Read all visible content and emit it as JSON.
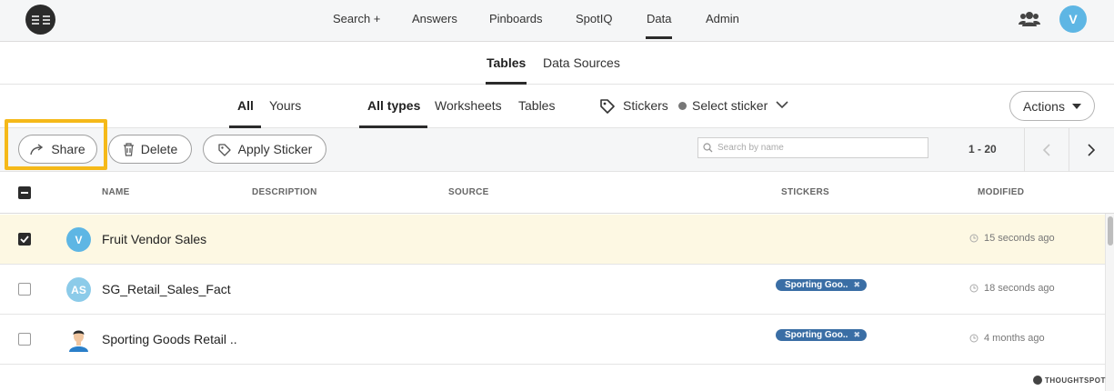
{
  "nav": {
    "logo_text": "SS",
    "items": [
      "Search +",
      "Answers",
      "Pinboards",
      "SpotIQ",
      "Data",
      "Admin"
    ],
    "active": "Data",
    "user_initial": "V"
  },
  "subtabs": [
    "Tables",
    "Data Sources"
  ],
  "filters": {
    "owner": [
      "All",
      "Yours"
    ],
    "types": [
      "All types",
      "Worksheets",
      "Tables"
    ],
    "stickers_label": "Stickers",
    "select_sticker": "Select sticker",
    "actions_label": "Actions"
  },
  "toolbar": {
    "share_label": "Share",
    "delete_label": "Delete",
    "apply_sticker_label": "Apply Sticker",
    "search_placeholder": "Search by name",
    "page_range": "1 - 20"
  },
  "table": {
    "columns": [
      "NAME",
      "DESCRIPTION",
      "SOURCE",
      "STICKERS",
      "MODIFIED"
    ],
    "rows": [
      {
        "checked": true,
        "avatar": "V",
        "name": "Fruit Vendor Sales",
        "sticker": "",
        "modified": "15 seconds ago"
      },
      {
        "checked": false,
        "avatar": "AS",
        "name": "SG_Retail_Sales_Fact",
        "sticker": "Sporting Goo..",
        "modified": "18 seconds ago"
      },
      {
        "checked": false,
        "avatar": "person",
        "name": "Sporting Goods Retail ..",
        "sticker": "Sporting Goo..",
        "modified": "4 months ago"
      }
    ]
  },
  "brand": "THOUGHTSPOT",
  "colors": {
    "accent": "#f5b919",
    "sticker": "#3a6ea5",
    "avatar": "#5eb6e4",
    "selected_row": "#fdf8e3"
  }
}
